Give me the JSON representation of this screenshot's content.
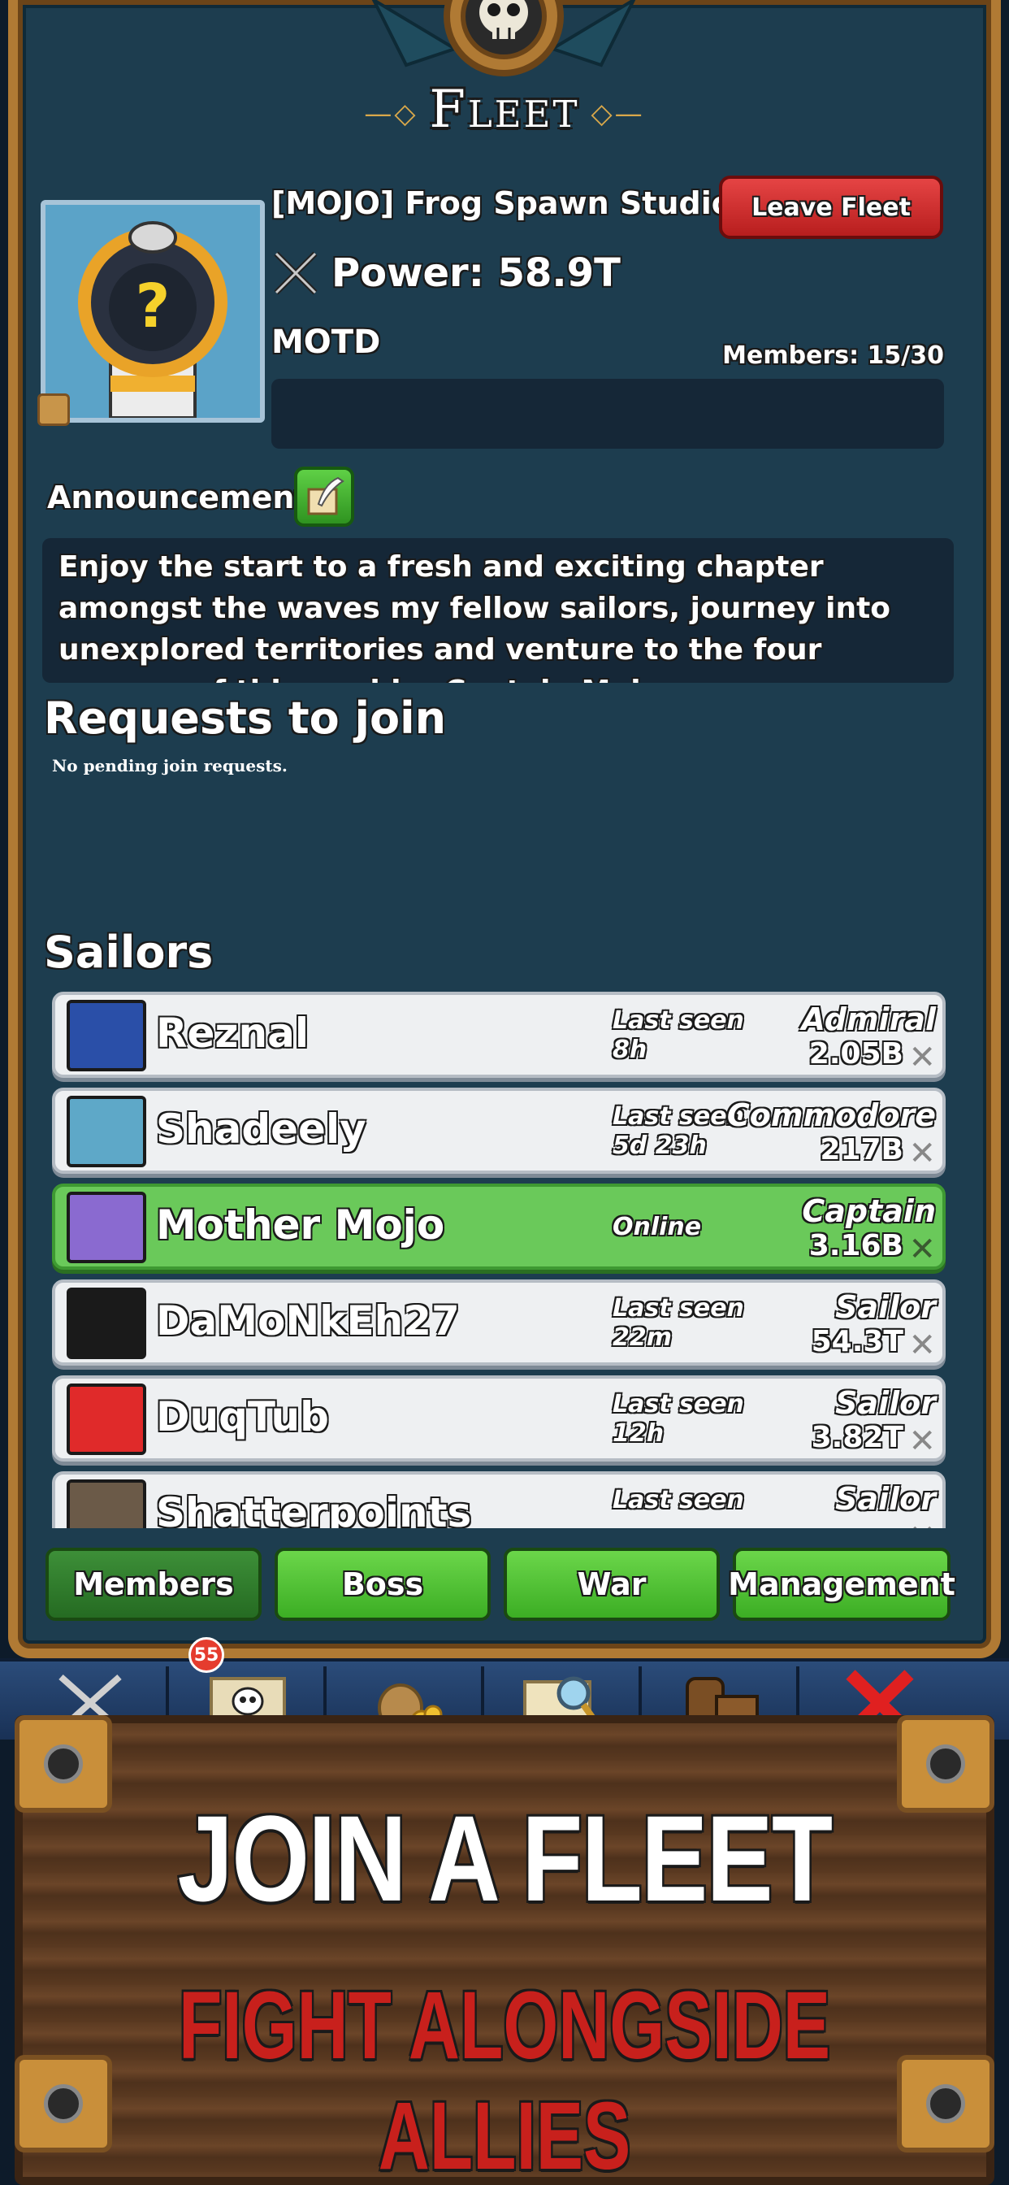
{
  "header": {
    "title": "Fleet"
  },
  "fleet": {
    "name": "[MOJO] Frog Spawn Studio",
    "leave_label": "Leave Fleet",
    "power_label": "Power: 58.9T",
    "motd_label": "MOTD",
    "members_count": "Members: 15/30",
    "motd_text": ""
  },
  "announcement": {
    "label": "Announcement",
    "text": "Enjoy the start to a fresh and exciting chapter amongst the waves my fellow sailors, journey into unexplored territories and venture to the four corners of this world. - Captain Mojo"
  },
  "requests": {
    "title": "Requests to join",
    "empty_text": "No pending join requests."
  },
  "sailors": {
    "title": "Sailors",
    "rows": [
      {
        "name": "Reznal",
        "seen_line1": "Last seen",
        "seen_line2": "8h",
        "rank": "Admiral",
        "power": "2.05B",
        "avatar_color": "#2a4fa8",
        "online": false
      },
      {
        "name": "Shadeely",
        "seen_line1": "Last seen",
        "seen_line2": "5d 23h",
        "rank": "Commodore",
        "power": "217B",
        "avatar_color": "#5ea8c8",
        "online": false
      },
      {
        "name": "Mother Mojo",
        "seen_line1": "Online",
        "seen_line2": "",
        "rank": "Captain",
        "power": "3.16B",
        "avatar_color": "#8a6ad0",
        "online": true
      },
      {
        "name": "DaMoNkEh27",
        "seen_line1": "Last seen",
        "seen_line2": "22m",
        "rank": "Sailor",
        "power": "54.3T",
        "avatar_color": "#1a1a1a",
        "online": false
      },
      {
        "name": "DuqTub",
        "seen_line1": "Last seen",
        "seen_line2": "12h",
        "rank": "Sailor",
        "power": "3.82T",
        "avatar_color": "#e02a2a",
        "online": false
      },
      {
        "name": "Shatterpoints",
        "seen_line1": "Last seen",
        "seen_line2": "",
        "rank": "Sailor",
        "power": "",
        "avatar_color": "#6b5a48",
        "online": false
      }
    ]
  },
  "tabs": [
    {
      "label": "Members",
      "active": true
    },
    {
      "label": "Boss",
      "active": false
    },
    {
      "label": "War",
      "active": false
    },
    {
      "label": "Management",
      "active": false
    }
  ],
  "nav": {
    "badge_count": "55",
    "icons": [
      "crossed-swords-icon",
      "skull-map-icon",
      "money-bag-icon",
      "treasure-map-icon",
      "barrels-icon",
      "close-icon"
    ]
  },
  "banner": {
    "headline": "JOIN A FLEET",
    "subline": "FIGHT ALONGSIDE ALLIES"
  },
  "colors": {
    "panel_bg": "#1d3d4f",
    "frame_gold": "#b07a34",
    "leave_red": "#d32f2f",
    "online_green": "#6ac95a",
    "tab_green": "#4cbb2e",
    "subline_red": "#c8201c"
  }
}
